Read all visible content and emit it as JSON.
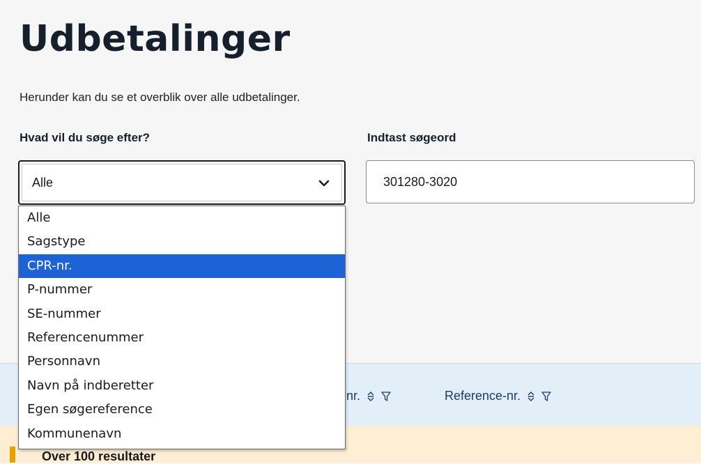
{
  "page": {
    "title": "Udbetalinger",
    "intro": "Herunder kan du se et overblik over alle udbetalinger."
  },
  "search": {
    "type_label": "Hvad vil du søge efter?",
    "type_value": "Alle",
    "keyword_label": "Indtast søgeord",
    "keyword_value": "301280-3020",
    "options": [
      "Alle",
      "Sagstype",
      "CPR-nr.",
      "P-nummer",
      "SE-nummer",
      "Referencenummer",
      "Personnavn",
      "Navn på indberetter",
      "Egen søgereference",
      "Kommunenavn"
    ],
    "highlighted_option": "CPR-nr."
  },
  "table": {
    "columns": [
      {
        "label": "nr.",
        "sort_icon": "sort-icon",
        "filter_icon": "filter-icon"
      },
      {
        "label": "Reference-nr.",
        "sort_icon": "sort-icon",
        "filter_icon": "filter-icon"
      }
    ],
    "result_text": "Over 100 resultater"
  },
  "colors": {
    "highlight": "#1e63d6",
    "header_bg": "#e2eff8",
    "result_bg": "#fdeed4",
    "result_bar": "#e5a100"
  }
}
